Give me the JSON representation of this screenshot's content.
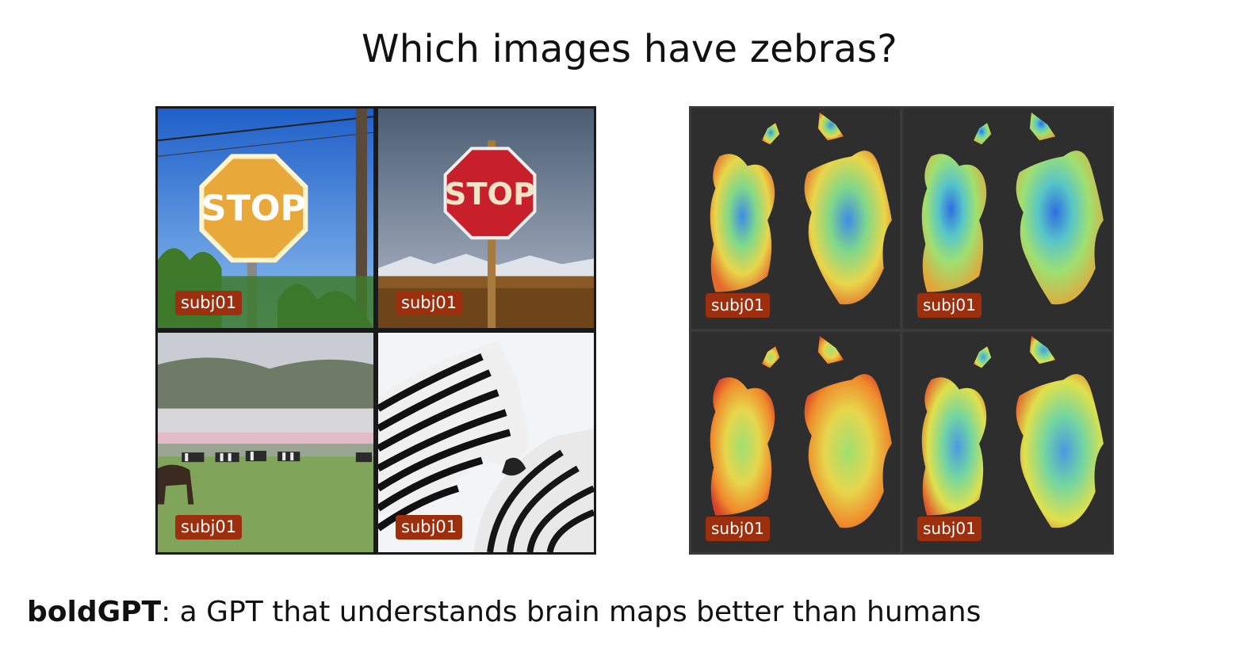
{
  "title": "Which images have zebras?",
  "photos": [
    {
      "label": "subj01",
      "scene": "stop-sign-sky"
    },
    {
      "label": "subj01",
      "scene": "stop-sign-dusk"
    },
    {
      "label": "subj01",
      "scene": "zebra-herd"
    },
    {
      "label": "subj01",
      "scene": "zebra-closeup"
    }
  ],
  "brain_maps": [
    {
      "label": "subj01"
    },
    {
      "label": "subj01"
    },
    {
      "label": "subj01"
    },
    {
      "label": "subj01"
    }
  ],
  "caption": {
    "bold": "boldGPT",
    "rest": ": a GPT that understands brain maps better than humans"
  },
  "colors": {
    "badge": "#9c2f0e",
    "brain_bg": "#3a3a3a",
    "stop_red": "#c8202a"
  }
}
